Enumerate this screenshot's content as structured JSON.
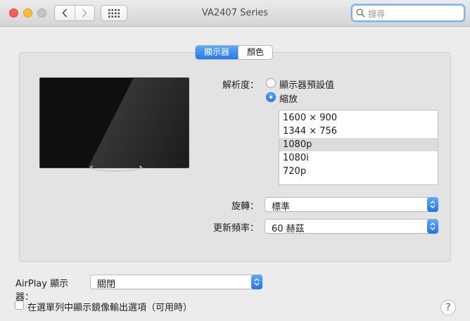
{
  "window": {
    "title": "VA2407 Series"
  },
  "toolbar": {
    "search_placeholder": "搜尋"
  },
  "tabs": [
    {
      "label": "顯示器",
      "active": true
    },
    {
      "label": "顏色",
      "active": false
    }
  ],
  "resolution": {
    "label": "解析度：",
    "options": [
      {
        "label": "顯示器預設值",
        "selected": false
      },
      {
        "label": "縮放",
        "selected": true
      }
    ],
    "list": [
      "1600 × 900",
      "1344 × 756",
      "1080p",
      "1080i",
      "720p"
    ],
    "selected_index": 2
  },
  "rotation": {
    "label": "旋轉：",
    "value": "標準"
  },
  "refresh": {
    "label": "更新頻率：",
    "value": "60 赫茲"
  },
  "airplay": {
    "label": "AirPlay 顯示器：",
    "value": "關閉"
  },
  "mirror_option": {
    "label": "在選單列中顯示鏡像輸出選項（可用時）",
    "checked": false
  },
  "help": {
    "label": "?"
  },
  "colors": {
    "accent": "#2a7df0",
    "close": "#fc5f57",
    "minimize": "#fdbc2e"
  }
}
